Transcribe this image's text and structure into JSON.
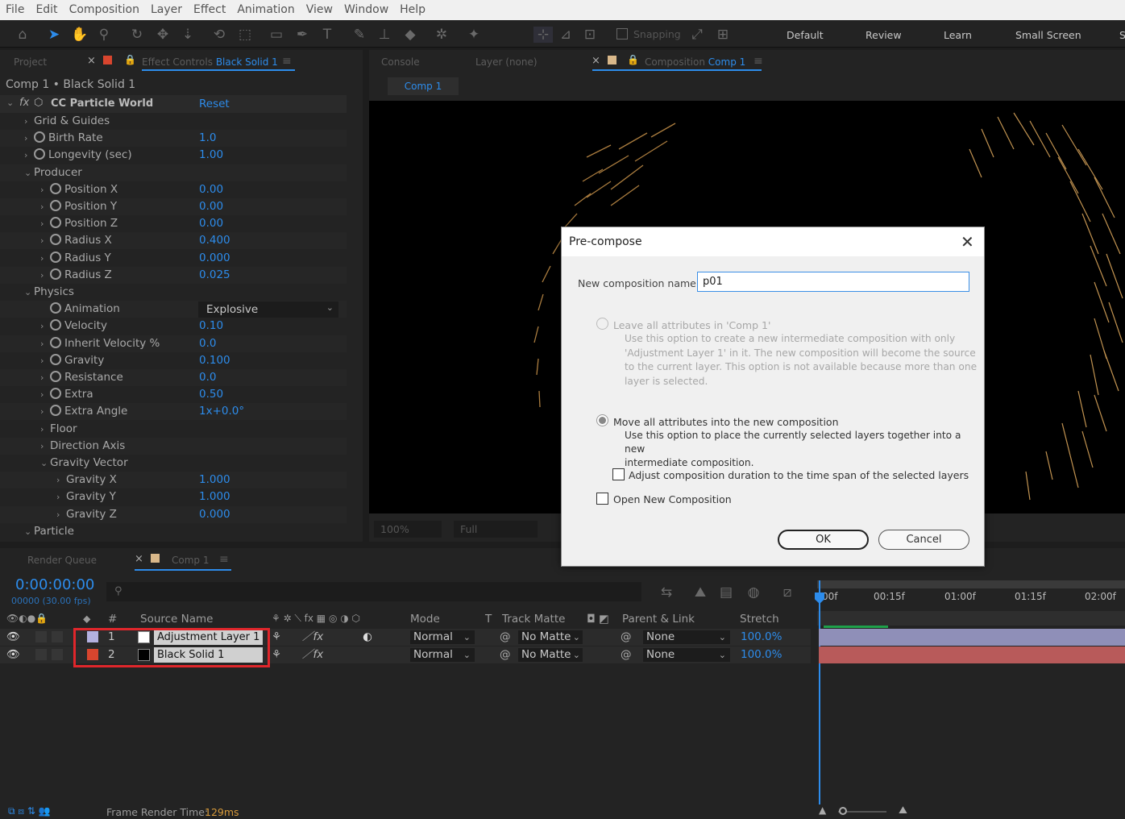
{
  "menu": [
    "File",
    "Edit",
    "Composition",
    "Layer",
    "Effect",
    "Animation",
    "View",
    "Window",
    "Help"
  ],
  "toolbar": {
    "snapping": "Snapping",
    "workspaces": [
      "Default",
      "Review",
      "Learn",
      "Small Screen",
      "S"
    ]
  },
  "left_tabs": {
    "project": "Project",
    "effect_controls_prefix": "Effect Controls",
    "effect_controls_layer": "Black Solid 1"
  },
  "effect_panel": {
    "header": "Comp 1 • Black Solid 1",
    "effect_name": "CC Particle World",
    "reset": "Reset",
    "rows": [
      {
        "label": "Grid & Guides",
        "value": ""
      },
      {
        "label": "Birth Rate",
        "value": "1.0"
      },
      {
        "label": "Longevity (sec)",
        "value": "1.00"
      },
      {
        "label": "Producer",
        "value": ""
      },
      {
        "label": "Position X",
        "value": "0.00"
      },
      {
        "label": "Position Y",
        "value": "0.00"
      },
      {
        "label": "Position Z",
        "value": "0.00"
      },
      {
        "label": "Radius X",
        "value": "0.400"
      },
      {
        "label": "Radius Y",
        "value": "0.000"
      },
      {
        "label": "Radius Z",
        "value": "0.025"
      },
      {
        "label": "Physics",
        "value": ""
      },
      {
        "label": "Animation",
        "value": "Explosive"
      },
      {
        "label": "Velocity",
        "value": "0.10"
      },
      {
        "label": "Inherit Velocity %",
        "value": "0.0"
      },
      {
        "label": "Gravity",
        "value": "0.100"
      },
      {
        "label": "Resistance",
        "value": "0.0"
      },
      {
        "label": "Extra",
        "value": "0.50"
      },
      {
        "label": "Extra Angle",
        "value": "1x+0.0°"
      },
      {
        "label": "Floor",
        "value": ""
      },
      {
        "label": "Direction Axis",
        "value": ""
      },
      {
        "label": "Gravity Vector",
        "value": ""
      },
      {
        "label": "Gravity X",
        "value": "1.000"
      },
      {
        "label": "Gravity Y",
        "value": "1.000"
      },
      {
        "label": "Gravity Z",
        "value": "0.000"
      },
      {
        "label": "Particle",
        "value": ""
      }
    ]
  },
  "viewer_tabs": {
    "console": "Console",
    "layer": "Layer (none)",
    "composition_prefix": "Composition",
    "composition_name": "Comp 1",
    "comp_chip": "Comp 1",
    "zoom": "100%",
    "resolution": "Full"
  },
  "dialog": {
    "title": "Pre-compose",
    "name_label": "New composition name:",
    "name_value": "p01",
    "option1_label": "Leave all attributes in 'Comp 1'",
    "option1_desc": [
      "Use this option to create a new intermediate composition with only",
      "'Adjustment Layer 1' in it. The new composition will become the source",
      "to the current layer. This option is not available because more than one",
      "layer is selected."
    ],
    "option2_label": "Move all attributes into the new composition",
    "option2_desc": [
      "Use this option to place the currently selected layers together into a new",
      "intermediate composition."
    ],
    "check1": "Adjust composition duration to the time span of the selected layers",
    "check2": "Open New Composition",
    "ok": "OK",
    "cancel": "Cancel"
  },
  "timeline": {
    "render_queue": "Render Queue",
    "comp_tab": "Comp 1",
    "timecode": "0:00:00:00",
    "frames": "00000 (30.00 fps)",
    "headers": {
      "num": "#",
      "source": "Source Name",
      "mode": "Mode",
      "t": "T",
      "track_matte": "Track Matte",
      "parent": "Parent & Link",
      "stretch": "Stretch"
    },
    "ruler": [
      "00f",
      "00:15f",
      "01:00f",
      "01:15f",
      "02:00f"
    ],
    "layers": [
      {
        "num": "1",
        "name": "Adjustment Layer 1",
        "mode": "Normal",
        "matte": "No Matte",
        "parent": "None",
        "stretch": "100.0%",
        "label_color": "#b3b1e0",
        "swatch": "#ffffff",
        "bar": "#8f8fb8"
      },
      {
        "num": "2",
        "name": "Black Solid 1",
        "mode": "Normal",
        "matte": "No Matte",
        "parent": "None",
        "stretch": "100.0%",
        "label_color": "#d8452e",
        "swatch": "#000000",
        "bar": "#b85a5a"
      }
    ]
  },
  "status": {
    "render_label": "Frame Render Time:",
    "render_value": "129ms"
  }
}
